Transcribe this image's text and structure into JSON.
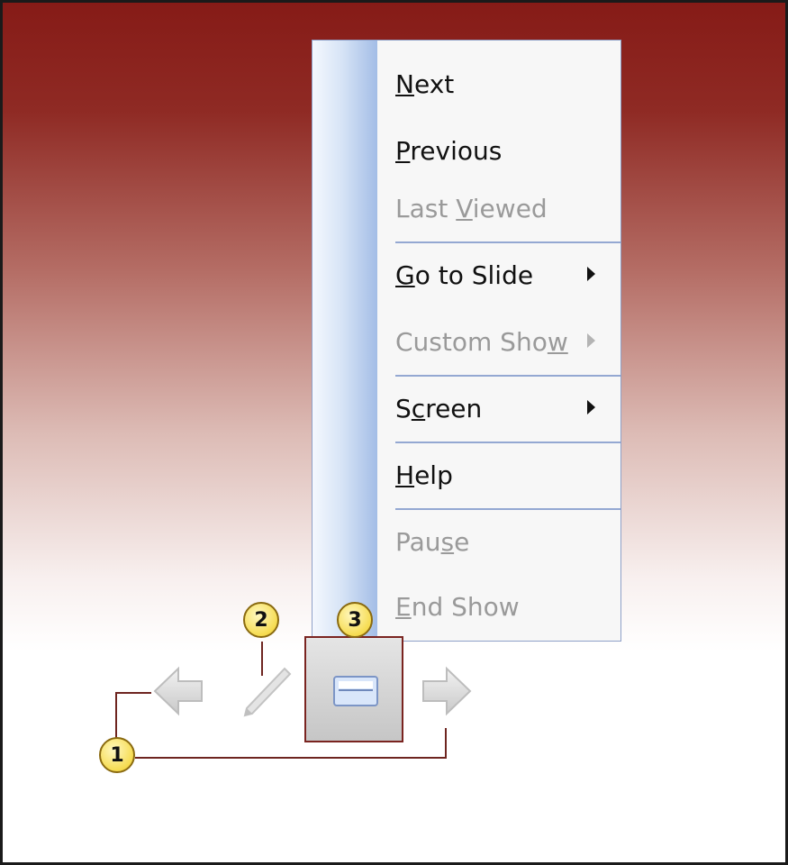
{
  "menu": {
    "items": [
      {
        "pre": "",
        "ul": "N",
        "post": "ext",
        "disabled": false,
        "submenu": false
      },
      {
        "pre": "",
        "ul": "P",
        "post": "revious",
        "disabled": false,
        "submenu": false
      },
      {
        "pre": "Last ",
        "ul": "V",
        "post": "iewed",
        "disabled": true,
        "submenu": false
      },
      {
        "pre": "",
        "ul": "G",
        "post": "o to Slide",
        "disabled": false,
        "submenu": true
      },
      {
        "pre": "Custom Sho",
        "ul": "w",
        "post": "",
        "disabled": true,
        "submenu": true
      },
      {
        "pre": "S",
        "ul": "c",
        "post": "reen",
        "disabled": false,
        "submenu": true
      },
      {
        "pre": "",
        "ul": "H",
        "post": "elp",
        "disabled": false,
        "submenu": false
      },
      {
        "pre": "Pau",
        "ul": "s",
        "post": "e",
        "disabled": true,
        "submenu": false
      },
      {
        "pre": "",
        "ul": "E",
        "post": "nd Show",
        "disabled": true,
        "submenu": false
      }
    ]
  },
  "callouts": {
    "one": "1",
    "two": "2",
    "three": "3"
  },
  "toolbar": {
    "buttons": [
      "previous-arrow-icon",
      "pen-icon",
      "menu-icon",
      "next-arrow-icon"
    ]
  },
  "colors": {
    "accent_dark_red": "#861b17",
    "callout_badge": "#f6dc52",
    "menu_separator": "#94a8d2"
  }
}
